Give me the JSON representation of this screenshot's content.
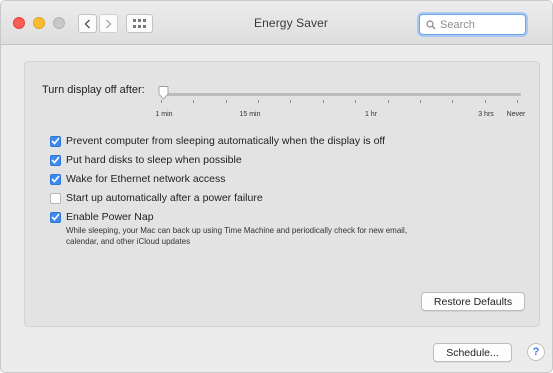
{
  "window": {
    "title": "Energy Saver",
    "search_placeholder": "Search"
  },
  "display_sleep": {
    "label": "Turn display off after:",
    "value": "1 min",
    "ticks": [
      "1 min",
      "15 min",
      "1 hr",
      "3 hrs",
      "Never"
    ]
  },
  "options": [
    {
      "label": "Prevent computer from sleeping automatically when the display is off",
      "checked": true
    },
    {
      "label": "Put hard disks to sleep when possible",
      "checked": true
    },
    {
      "label": "Wake for Ethernet network access",
      "checked": true
    },
    {
      "label": "Start up automatically after a power failure",
      "checked": false
    },
    {
      "label": "Enable Power Nap",
      "checked": true
    }
  ],
  "power_nap_description_line1": "While sleeping, your Mac can back up using Time Machine and periodically check for new email,",
  "power_nap_description_line2": "calendar, and other iCloud updates",
  "buttons": {
    "restore_defaults": "Restore Defaults",
    "schedule": "Schedule...",
    "help": "?"
  },
  "colors": {
    "accent": "#3d8bf0",
    "close": "#fd5d57",
    "minimize": "#fcbc2f",
    "zoom": "#c8c8c8"
  }
}
